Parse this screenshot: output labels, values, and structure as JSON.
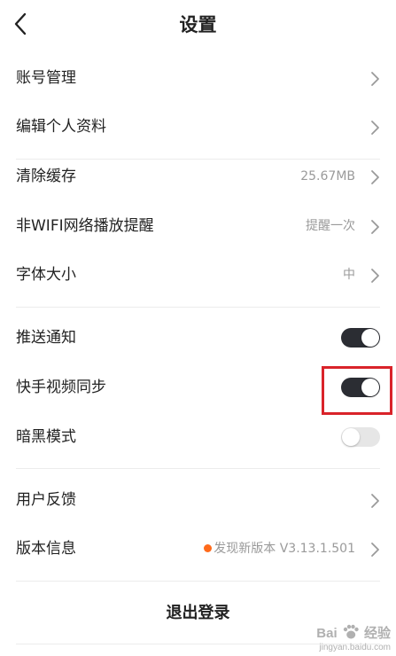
{
  "header": {
    "title": "设置"
  },
  "groups": [
    {
      "rows": [
        {
          "label": "账号管理",
          "value": ""
        },
        {
          "label": "编辑个人资料",
          "value": ""
        }
      ]
    },
    {
      "rows": [
        {
          "label": "清除缓存",
          "value": "25.67MB"
        },
        {
          "label": "非WIFI网络播放提醒",
          "value": "提醒一次"
        },
        {
          "label": "字体大小",
          "value": "中"
        }
      ]
    },
    {
      "rows": [
        {
          "label": "推送通知",
          "toggle": "on"
        },
        {
          "label": "快手视频同步",
          "toggle": "on"
        },
        {
          "label": "暗黑模式",
          "toggle": "off"
        }
      ]
    },
    {
      "rows": [
        {
          "label": "用户反馈",
          "value": ""
        },
        {
          "label": "版本信息",
          "value": "发现新版本 V3.13.1.501",
          "badge": true
        }
      ]
    }
  ],
  "logout": {
    "label": "退出登录"
  },
  "watermark": {
    "brand": "Bai",
    "brand_cn": "经验",
    "url": "jingyan.baidu.com"
  },
  "colors": {
    "toggle_on": "#2b2d33",
    "toggle_off": "#e6e6e6",
    "highlight": "#d9232a",
    "update_dot": "#ff6a1a"
  }
}
